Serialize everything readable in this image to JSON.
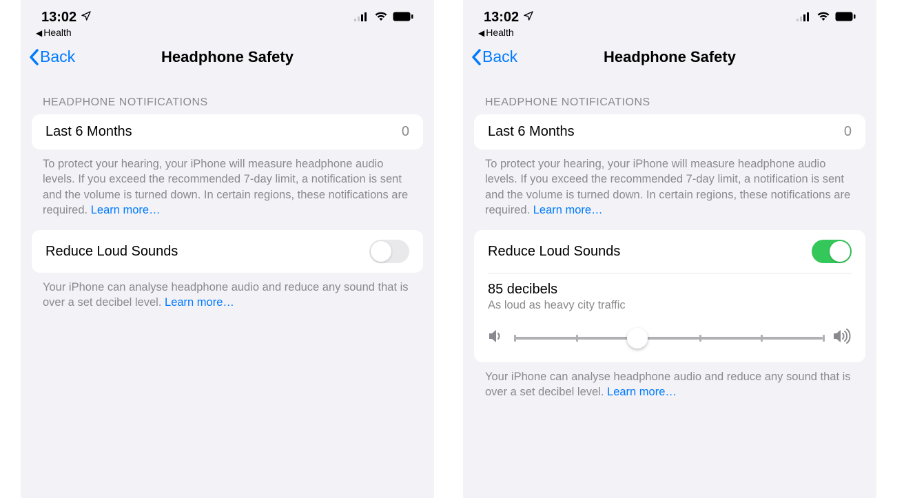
{
  "left": {
    "status": {
      "time": "13:02",
      "breadcrumb": "Health"
    },
    "nav": {
      "back": "Back",
      "title": "Headphone Safety"
    },
    "section1": {
      "header": "HEADPHONE NOTIFICATIONS",
      "row_label": "Last 6 Months",
      "row_value": "0",
      "footer": "To protect your hearing, your iPhone will measure headphone audio levels. If you exceed the recommended 7-day limit, a notification is sent and the volume is turned down. In certain regions, these notifications are required. ",
      "learn_more": "Learn more…"
    },
    "section2": {
      "row_label": "Reduce Loud Sounds",
      "toggle_on": false,
      "footer": "Your iPhone can analyse headphone audio and reduce any sound that is over a set decibel level. ",
      "learn_more": "Learn more…"
    }
  },
  "right": {
    "status": {
      "time": "13:02",
      "breadcrumb": "Health"
    },
    "nav": {
      "back": "Back",
      "title": "Headphone Safety"
    },
    "section1": {
      "header": "HEADPHONE NOTIFICATIONS",
      "row_label": "Last 6 Months",
      "row_value": "0",
      "footer": "To protect your hearing, your iPhone will measure headphone audio levels. If you exceed the recommended 7-day limit, a notification is sent and the volume is turned down. In certain regions, these notifications are required. ",
      "learn_more": "Learn more…"
    },
    "section2": {
      "row_label": "Reduce Loud Sounds",
      "toggle_on": true,
      "decibel_title": "85 decibels",
      "decibel_sub": "As loud as heavy city traffic",
      "slider_percent": 40,
      "footer": "Your iPhone can analyse headphone audio and reduce any sound that is over a set decibel level. ",
      "learn_more": "Learn more…"
    }
  }
}
